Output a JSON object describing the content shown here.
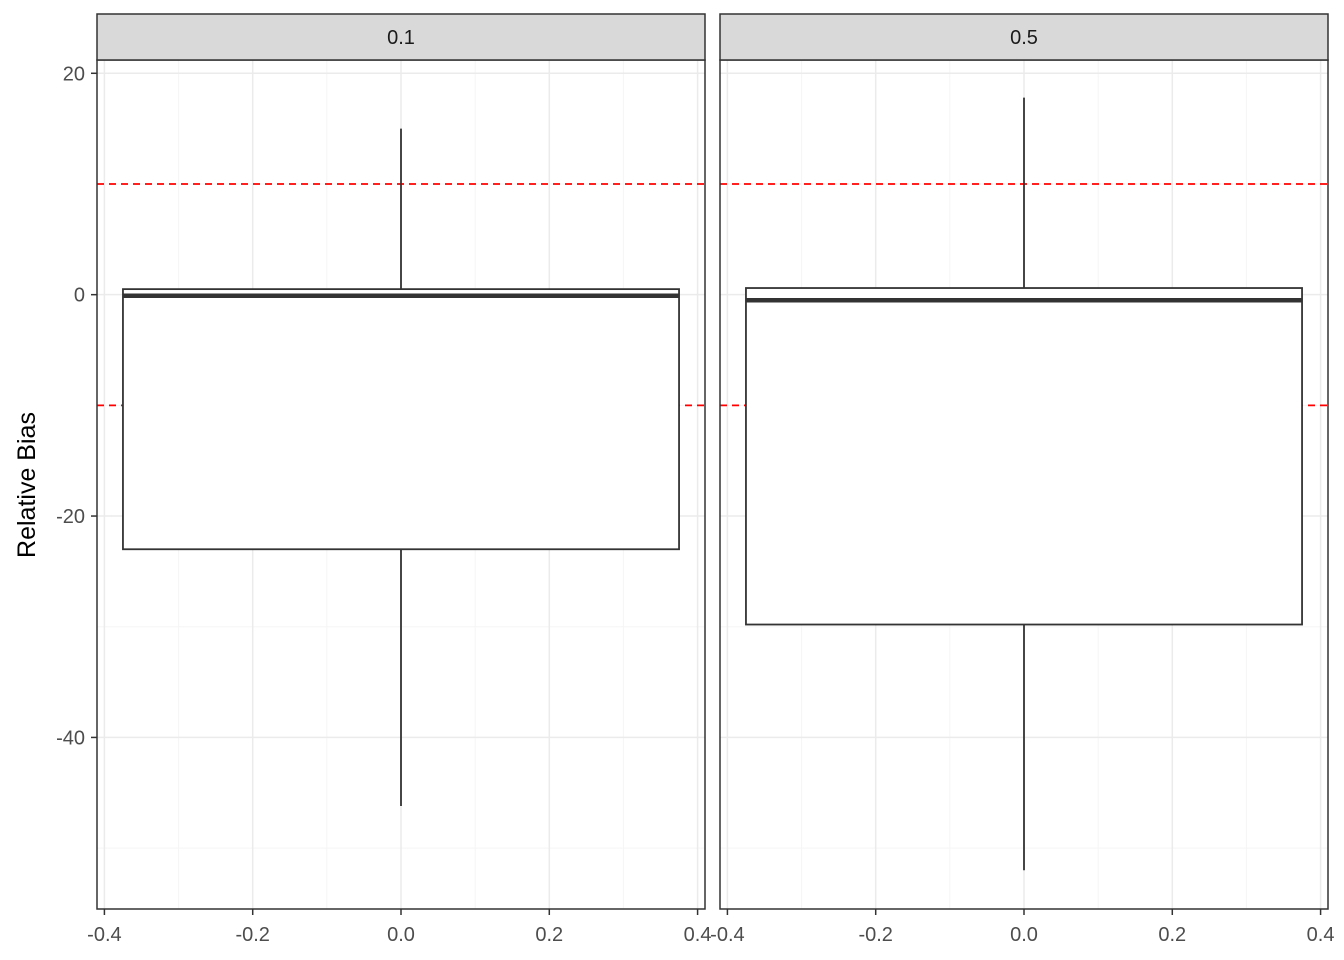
{
  "chart_data": {
    "type": "boxplot",
    "facet_variable_values": [
      "0.1",
      "0.5"
    ],
    "ylabel": "Relative Bias",
    "xlabel": "",
    "xlim": [
      -0.41,
      0.41
    ],
    "ylim": [
      -55.5,
      21.2
    ],
    "x_ticks": [
      -0.4,
      -0.2,
      0.0,
      0.2,
      0.4
    ],
    "x_tick_labels": [
      "-0.4",
      "-0.2",
      "0.0",
      "0.2",
      "0.4"
    ],
    "y_ticks": [
      -40,
      -20,
      0,
      20
    ],
    "y_tick_labels": [
      "-40",
      "-20",
      "0",
      "20"
    ],
    "reference_lines": {
      "values": [
        10,
        -10
      ],
      "color": "#ff0000",
      "style": "dashed"
    },
    "grid": true,
    "panels": [
      {
        "strip_label": "0.1",
        "box": {
          "x_min": -0.375,
          "x_max": 0.375,
          "whisker_low": -46.2,
          "q1": -23.0,
          "median": -0.1,
          "q3": 0.5,
          "whisker_high": 15.0
        }
      },
      {
        "strip_label": "0.5",
        "box": {
          "x_min": -0.375,
          "x_max": 0.375,
          "whisker_low": -52.0,
          "q1": -29.8,
          "median": -0.5,
          "q3": 0.6,
          "whisker_high": 17.8
        }
      }
    ],
    "colors": {
      "strip_fill": "#d9d9d9",
      "panel_border": "#333333",
      "grid_major": "#ebebeb",
      "grid_minor": "#f5f5f5",
      "box_line": "#333333",
      "ref_line": "#ff0000",
      "tick_text": "#4d4d4d"
    }
  }
}
